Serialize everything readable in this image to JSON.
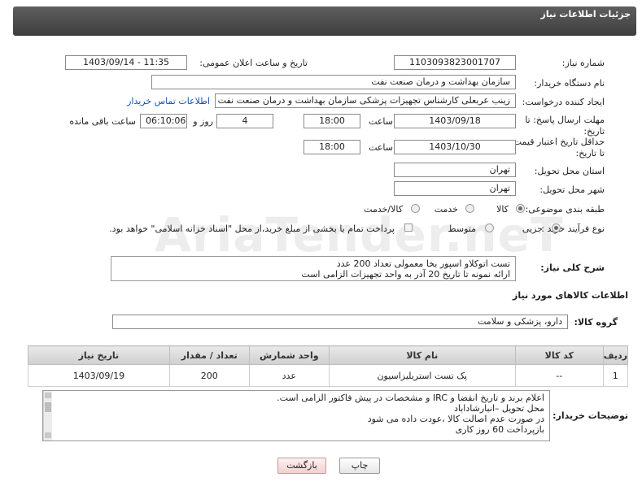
{
  "header": {
    "title": "جزئیات اطلاعات نیاز"
  },
  "watermark": "AriaTender.neT",
  "fields": {
    "need_number": {
      "label": "شماره نیاز:",
      "value": "1103093823001707"
    },
    "announce": {
      "label": "تاریخ و ساعت اعلان عمومی:",
      "value": "1403/09/14 - 11:35"
    },
    "buyer_org": {
      "label": "نام دستگاه خریدار:",
      "value": "سازمان بهداشت و درمان صنعت نفت"
    },
    "creator": {
      "label": "ایجاد کننده درخواست:",
      "value": "زینب عربعلی کارشناس تجهیزات پزشکی سازمان بهداشت و درمان صنعت نفت",
      "link": "اطلاعات تماس خریدار"
    },
    "send_deadline": {
      "label": "مهلت ارسال پاسخ: تا تاریخ:",
      "date": "1403/09/18",
      "time_label": "ساعت",
      "time": "18:00",
      "days": "4",
      "days_label": "روز و",
      "remaining": "06:10:06",
      "remaining_label": "ساعت باقی مانده"
    },
    "price_validity": {
      "label": "حداقل تاریخ اعتبار قیمت: تا تاریخ:",
      "date": "1403/10/30",
      "time_label": "ساعت",
      "time": "18:00"
    },
    "province": {
      "label": "استان محل تحویل:",
      "value": "تهران"
    },
    "city": {
      "label": "شهر محل تحویل:",
      "value": "تهران"
    },
    "category": {
      "label": "طبقه بندی موضوعی:",
      "options": [
        "کالا",
        "خدمت",
        "کالا/خدمت"
      ],
      "selected": 0
    },
    "process": {
      "label": "نوع فرآیند خرید :",
      "options": [
        "جزیی",
        "متوسط"
      ],
      "selected": 0,
      "note": "پرداخت تمام یا بخشی از مبلغ خرید،از محل \"اسناد خزانه اسلامی\" خواهد بود."
    }
  },
  "summary": {
    "label": "شرح کلی نیاز:",
    "lines": [
      "تست اتوکلاو اسپور بخا معمولی تعداد 200 عدد",
      "ارائه نمونه تا تاریخ 20 آذر به واحد تجهیزات الزامی است"
    ]
  },
  "goods_section": {
    "title": "اطلاعات کالاهای مورد نیاز",
    "group_label": "گروه کالا:",
    "group_value": "دارو، پزشکی و سلامت"
  },
  "table": {
    "headers": [
      "ردیف",
      "کد کالا",
      "نام کالا",
      "واحد شمارش",
      "تعداد / مقدار",
      "تاریخ نیاز"
    ],
    "rows": [
      [
        "1",
        "--",
        "پک تست استریلیزاسیون",
        "عدد",
        "200",
        "1403/09/19"
      ]
    ]
  },
  "buyer_notes": {
    "label": "توضیحات خریدار:",
    "lines": [
      "اعلام برند و تاریخ انقضا  و IRC  و مشخصات  در پیش فاکتور الزامی است.",
      "محل تحویل –انبارشاداباد",
      "در صورت عدم اصالت کالا ،عودت داده می شود",
      "بازپرداخت 60 روز کاری"
    ]
  },
  "buttons": {
    "print": "چاپ",
    "back": "بازگشت"
  }
}
